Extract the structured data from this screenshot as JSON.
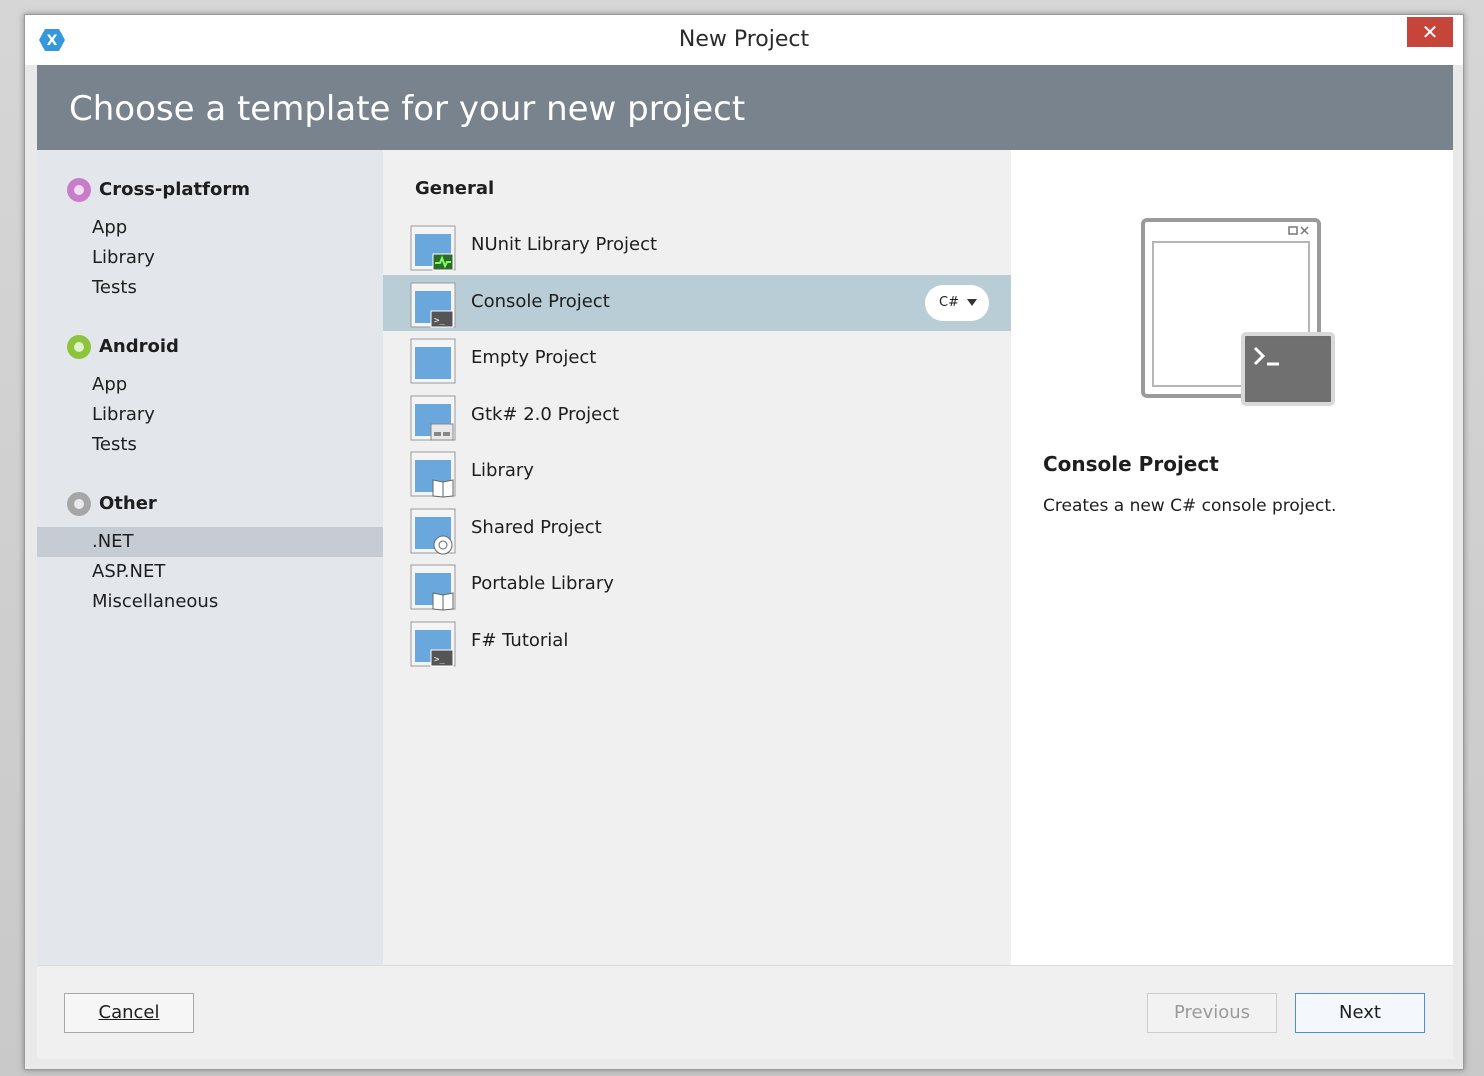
{
  "window": {
    "title": "New Project",
    "close_glyph": "✕"
  },
  "header": {
    "title": "Choose a template for your new project"
  },
  "categories": [
    {
      "name": "Cross-platform",
      "bullet_color": "#c97dc9",
      "items": [
        "App",
        "Library",
        "Tests"
      ]
    },
    {
      "name": "Android",
      "bullet_color": "#8cc43c",
      "items": [
        "App",
        "Library",
        "Tests"
      ]
    },
    {
      "name": "Other",
      "bullet_color": "#a6a6a6",
      "items": [
        ".NET",
        "ASP.NET",
        "Miscellaneous"
      ],
      "selected_item": ".NET"
    }
  ],
  "templates": {
    "section": "General",
    "items": [
      {
        "label": "NUnit Library Project",
        "icon": "nunit-icon"
      },
      {
        "label": "Console Project",
        "icon": "console-icon",
        "selected": true,
        "language": "C#"
      },
      {
        "label": "Empty Project",
        "icon": "empty-project-icon"
      },
      {
        "label": "Gtk# 2.0 Project",
        "icon": "gtk-icon"
      },
      {
        "label": "Library",
        "icon": "library-icon"
      },
      {
        "label": "Shared Project",
        "icon": "shared-project-icon"
      },
      {
        "label": "Portable Library",
        "icon": "portable-library-icon"
      },
      {
        "label": "F# Tutorial",
        "icon": "console-icon"
      }
    ]
  },
  "detail": {
    "title": "Console Project",
    "description": "Creates a new C# console project."
  },
  "footer": {
    "cancel_label": "Cancel",
    "previous_label": "Previous",
    "next_label": "Next"
  },
  "colors": {
    "banner": "#78838e",
    "selected_template": "#b9cdd6",
    "selected_category": "#c5ccd4",
    "close_button": "#c7443a"
  }
}
